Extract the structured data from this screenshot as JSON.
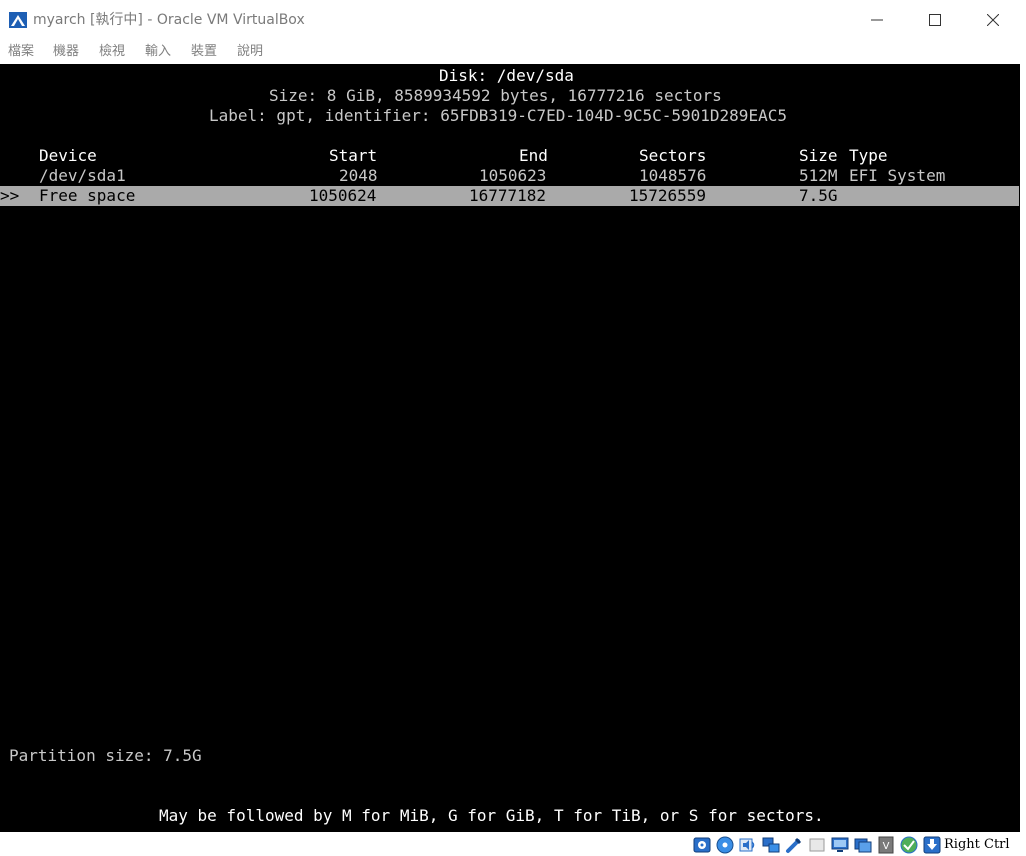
{
  "window": {
    "title": "myarch [執行中] - Oracle VM VirtualBox"
  },
  "menu": {
    "items": [
      {
        "label": "檔案"
      },
      {
        "label": "機器"
      },
      {
        "label": "檢視"
      },
      {
        "label": "輸入"
      },
      {
        "label": "裝置"
      },
      {
        "label": "說明"
      }
    ]
  },
  "terminal": {
    "disk_line": "Disk: /dev/sda",
    "size_line": "Size: 8 GiB, 8589934592 bytes, 16777216 sectors",
    "label_line": "Label: gpt, identifier: 65FDB319-C7ED-104D-9C5C-5901D289EAC5",
    "columns": {
      "device": "Device",
      "start": "Start",
      "end": "End",
      "sectors": "Sectors",
      "size": "Size",
      "type": "Type"
    },
    "rows": [
      {
        "marker": "",
        "device": "/dev/sda1",
        "start": "2048",
        "end": "1050623",
        "sectors": "1048576",
        "size": "512M",
        "type": "EFI System"
      },
      {
        "marker": ">>",
        "device": "Free space",
        "start": "1050624",
        "end": "16777182",
        "sectors": "15726559",
        "size": "7.5G",
        "type": ""
      }
    ],
    "prompt": "Partition size: 7.5G",
    "hint": "May be followed by M for MiB, G for GiB, T for TiB, or S for sectors."
  },
  "statusbar": {
    "icons": [
      "hard-disk-icon",
      "optical-disc-icon",
      "audio-icon",
      "network-icon",
      "usb-icon",
      "shared-folder-icon",
      "display-icon",
      "screen-record-icon",
      "vrde-icon",
      "cpu-virtualization-icon",
      "mouse-integration-icon",
      "keyboard-capture-icon"
    ],
    "host_key": "Right Ctrl"
  },
  "colors": {
    "terminal_bg": "#000000",
    "terminal_fg": "#ffffff",
    "selection_bg": "#aaaaaa",
    "virtualbox_blue": "#1e5fb4"
  }
}
